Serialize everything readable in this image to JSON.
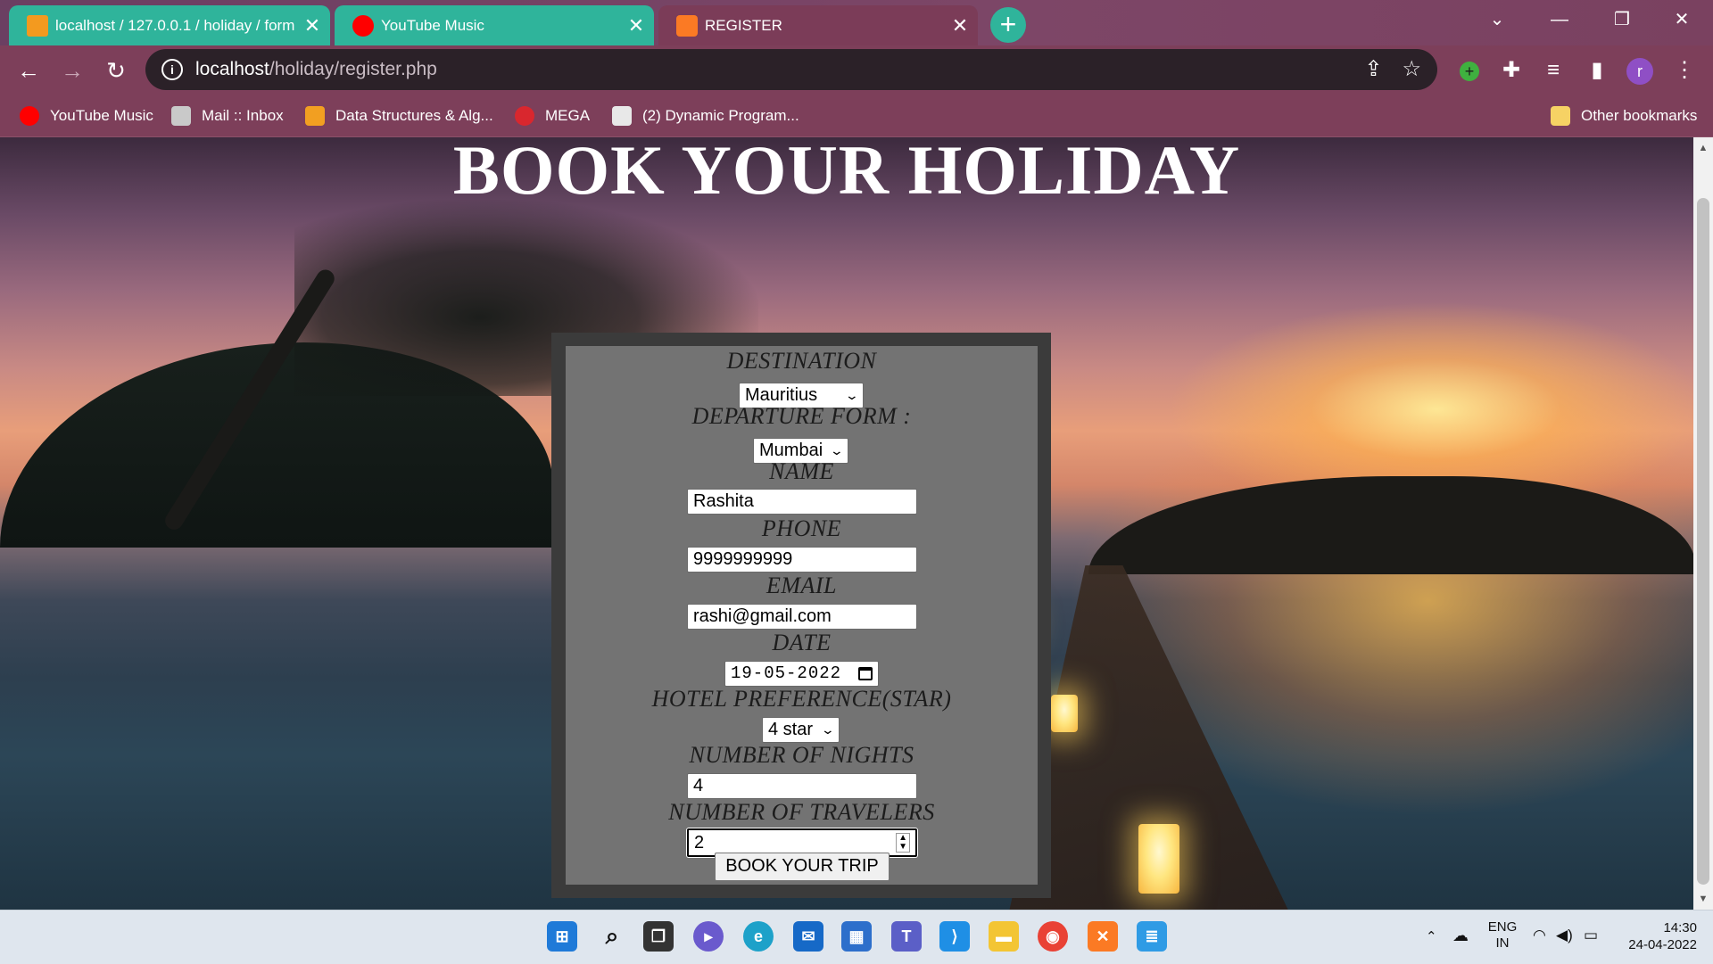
{
  "browser": {
    "tabs": [
      {
        "title": "localhost / 127.0.0.1 / holiday / form",
        "favicon": "phpmyadmin-icon",
        "color": "#f39a1f"
      },
      {
        "title": "YouTube Music",
        "favicon": "youtube-music-icon",
        "color": "#ff0000"
      },
      {
        "title": "REGISTER",
        "favicon": "xampp-icon",
        "color": "#fb7a24"
      }
    ],
    "url_host": "localhost",
    "url_path": "/holiday/register.php",
    "profile_initial": "r",
    "bookmarks": [
      {
        "label": "YouTube Music",
        "icon": "youtube-music-icon"
      },
      {
        "label": "Mail :: Inbox",
        "icon": "mail-icon"
      },
      {
        "label": "Data Structures & Alg...",
        "icon": "gfg-icon"
      },
      {
        "label": "MEGA",
        "icon": "mega-icon"
      },
      {
        "label": "(2) Dynamic Program...",
        "icon": "codechef-icon"
      }
    ],
    "other_bookmarks": "Other bookmarks"
  },
  "page": {
    "title": "BOOK YOUR HOLIDAY",
    "form": {
      "destination_label": "DESTINATION",
      "destination_value": "Mauritius",
      "departure_label": "DEPARTURE FORM :",
      "departure_value": "Mumbai",
      "name_label": "NAME",
      "name_value": "Rashita",
      "phone_label": "PHONE",
      "phone_value": "9999999999",
      "email_label": "EMAIL",
      "email_value": "rashi@gmail.com",
      "date_label": "DATE",
      "date_value": "19-05-2022",
      "hotel_label": "HOTEL PREFERENCE(STAR)",
      "hotel_value": "4 star",
      "nights_label": "NUMBER OF NIGHTS",
      "nights_value": "4",
      "travelers_label": "NUMBER OF TRAVELERS",
      "travelers_value": "2",
      "submit_label": "BOOK YOUR TRIP"
    }
  },
  "taskbar": {
    "language_line1": "ENG",
    "language_line2": "IN",
    "time": "14:30",
    "date": "24-04-2022"
  }
}
